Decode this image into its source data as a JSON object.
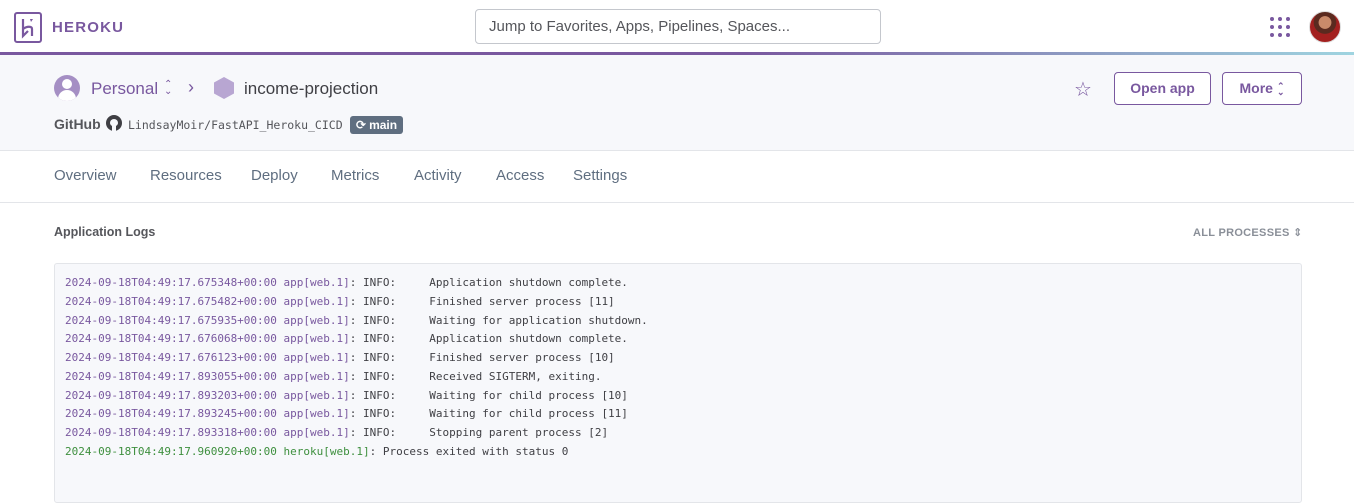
{
  "header": {
    "brand": "HEROKU",
    "search_placeholder": "Jump to Favorites, Apps, Pipelines, Spaces..."
  },
  "app_header": {
    "org": "Personal",
    "app_name": "income-projection",
    "github_label": "GitHub",
    "repo": "LindsayMoir/FastAPI_Heroku_CICD",
    "branch": "main",
    "open_app": "Open app",
    "more": "More"
  },
  "tabs": [
    "Overview",
    "Resources",
    "Deploy",
    "Metrics",
    "Activity",
    "Access",
    "Settings"
  ],
  "logs": {
    "title": "Application Logs",
    "process_filter": "ALL PROCESSES",
    "lines": [
      {
        "ts": "2024-09-18T04:49:17.675348+00:00",
        "src": "app[web.1]",
        "msg": ": INFO:     Application shutdown complete.",
        "kind": "app"
      },
      {
        "ts": "2024-09-18T04:49:17.675482+00:00",
        "src": "app[web.1]",
        "msg": ": INFO:     Finished server process [11]",
        "kind": "app"
      },
      {
        "ts": "2024-09-18T04:49:17.675935+00:00",
        "src": "app[web.1]",
        "msg": ": INFO:     Waiting for application shutdown.",
        "kind": "app"
      },
      {
        "ts": "2024-09-18T04:49:17.676068+00:00",
        "src": "app[web.1]",
        "msg": ": INFO:     Application shutdown complete.",
        "kind": "app"
      },
      {
        "ts": "2024-09-18T04:49:17.676123+00:00",
        "src": "app[web.1]",
        "msg": ": INFO:     Finished server process [10]",
        "kind": "app"
      },
      {
        "ts": "2024-09-18T04:49:17.893055+00:00",
        "src": "app[web.1]",
        "msg": ": INFO:     Received SIGTERM, exiting.",
        "kind": "app"
      },
      {
        "ts": "2024-09-18T04:49:17.893203+00:00",
        "src": "app[web.1]",
        "msg": ": INFO:     Waiting for child process [10]",
        "kind": "app"
      },
      {
        "ts": "2024-09-18T04:49:17.893245+00:00",
        "src": "app[web.1]",
        "msg": ": INFO:     Waiting for child process [11]",
        "kind": "app"
      },
      {
        "ts": "2024-09-18T04:49:17.893318+00:00",
        "src": "app[web.1]",
        "msg": ": INFO:     Stopping parent process [2]",
        "kind": "app"
      },
      {
        "ts": "2024-09-18T04:49:17.960920+00:00",
        "src": "heroku[web.1]",
        "msg": ": Process exited with status 0",
        "kind": "heroku"
      }
    ]
  },
  "colors": {
    "brand": "#79589f",
    "heroku_log": "#3e8f3e"
  }
}
